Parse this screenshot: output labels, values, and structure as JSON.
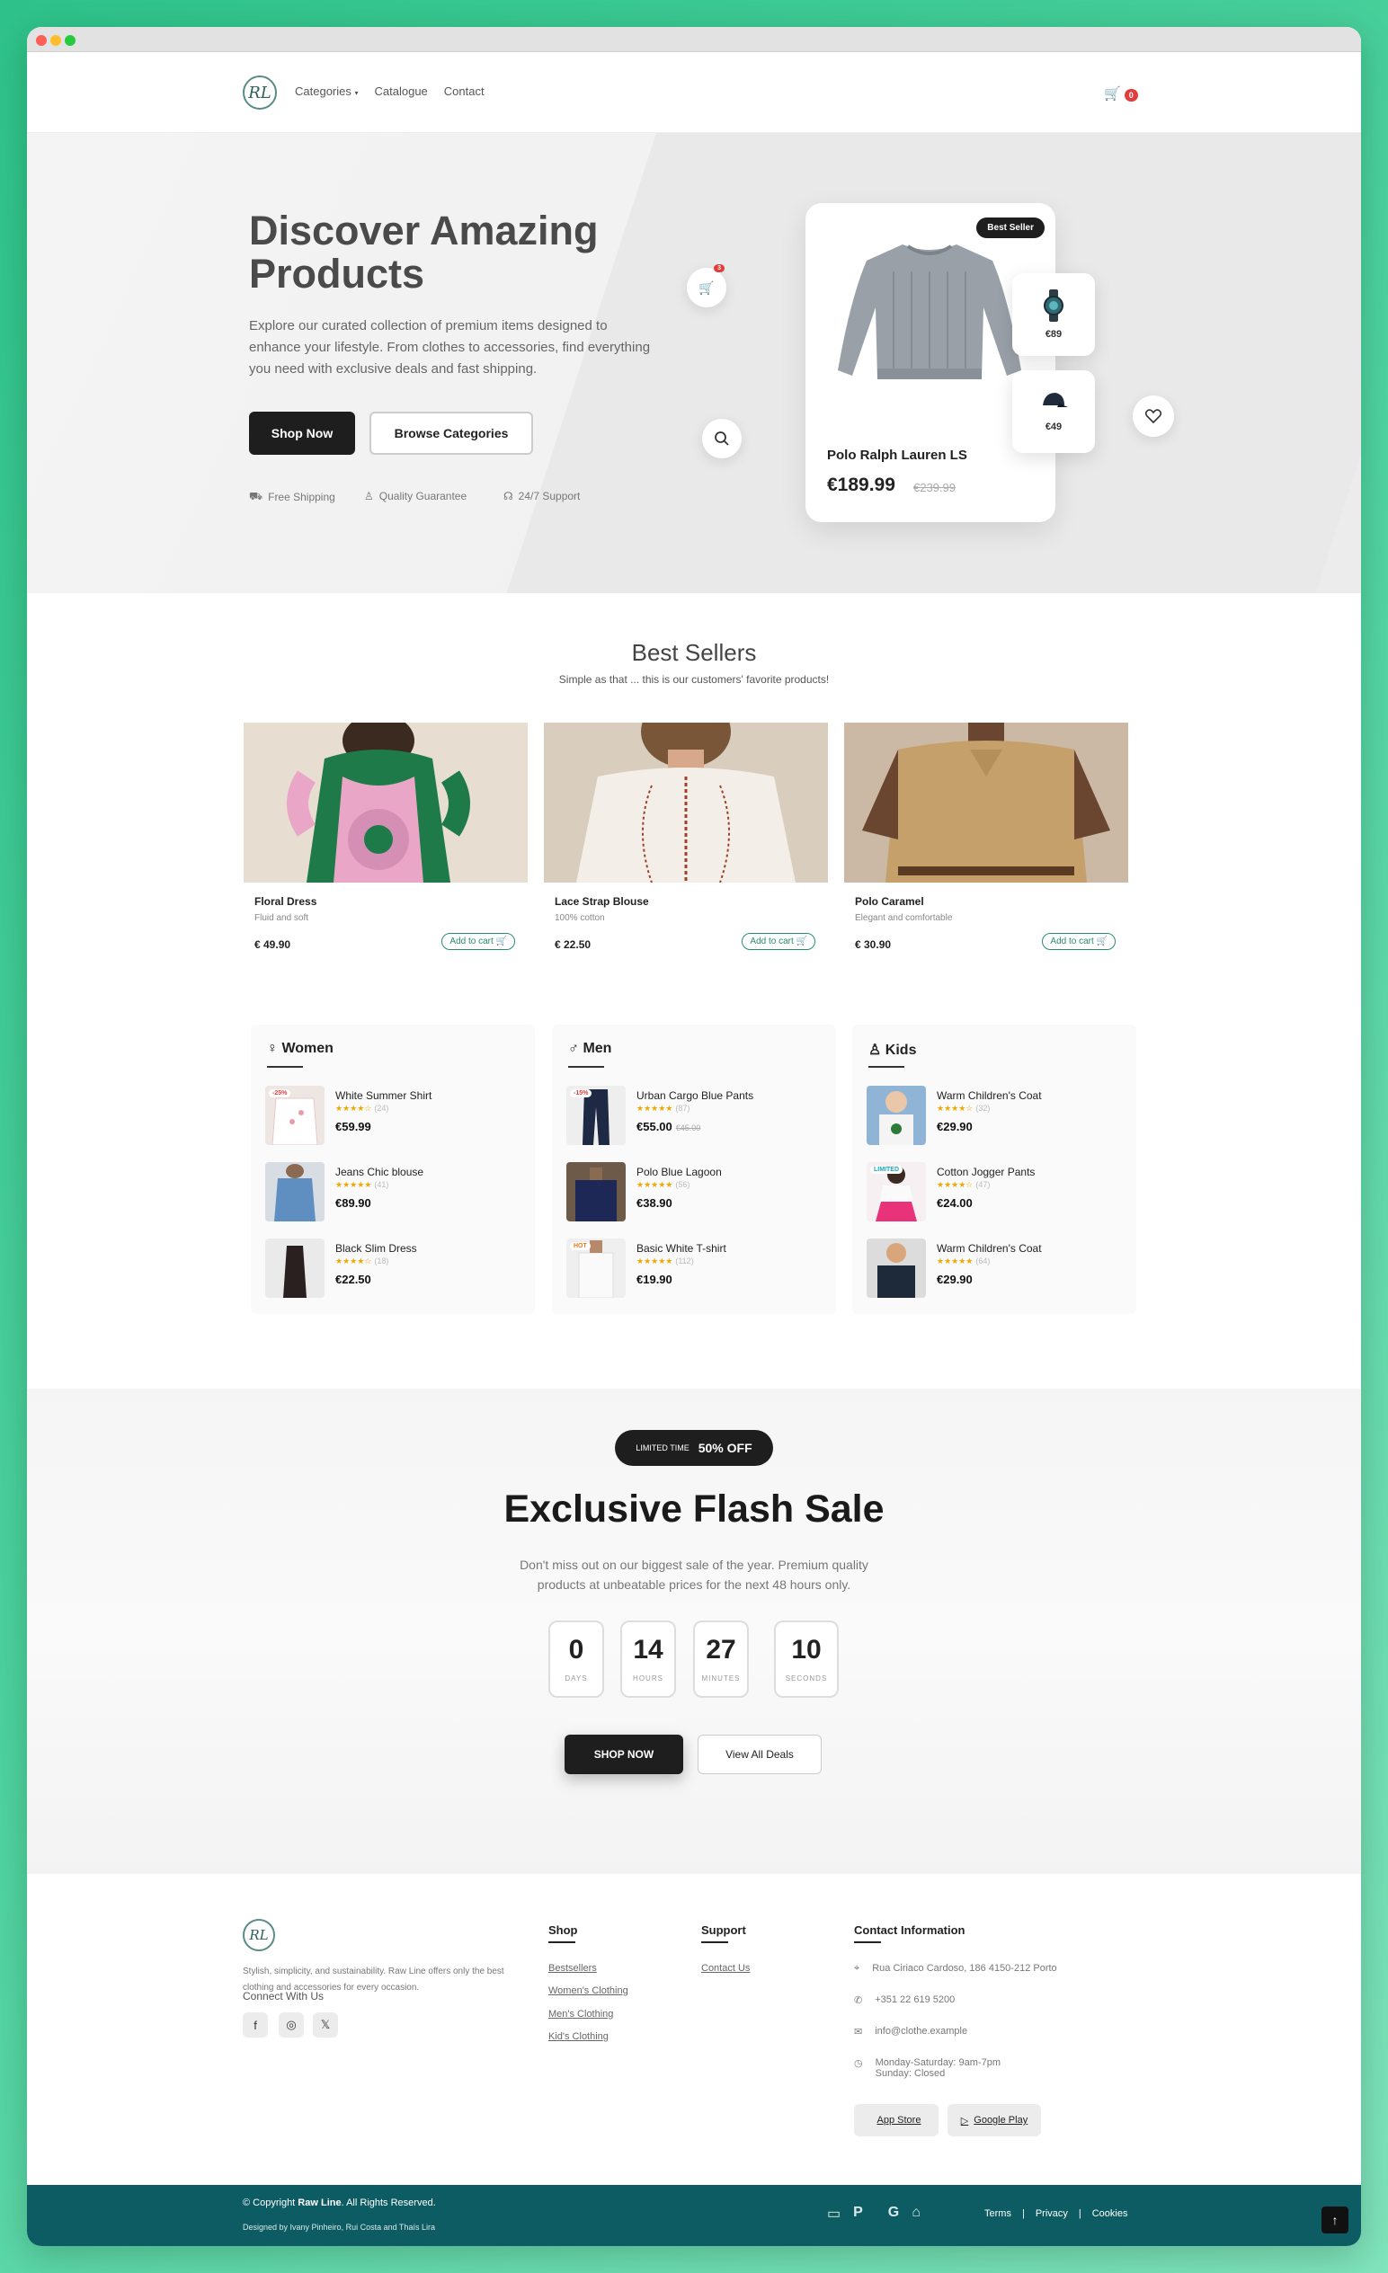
{
  "nav": {
    "categories": "Categories",
    "catalogue": "Catalogue",
    "contact": "Contact",
    "cart_count": "0",
    "logo_text": "RL"
  },
  "hero": {
    "title": "Discover Amazing Products",
    "description": "Explore our curated collection of premium items designed to enhance your lifestyle. From clothes to accessories, find everything you need with exclusive deals and fast shipping.",
    "shop_now": "Shop Now",
    "browse": "Browse Categories",
    "features": [
      "Free Shipping",
      "Quality Guarantee",
      "24/7 Support"
    ],
    "cart_bubble": "3",
    "product": {
      "badge": "Best Seller",
      "name": "Polo Ralph Lauren LS",
      "price": "€189.99",
      "old_price": "€239.99"
    },
    "mini_watch_price": "€89",
    "mini_cap_price": "€49"
  },
  "best_sellers": {
    "title": "Best Sellers",
    "subtitle": "Simple as that ... this is our customers' favorite products!",
    "items": [
      {
        "name": "Floral Dress",
        "desc": "Fluid and soft",
        "price": "€ 49.90",
        "cta": "Add to cart"
      },
      {
        "name": "Lace Strap Blouse",
        "desc": "100% cotton",
        "price": "€ 22.50",
        "cta": "Add to cart"
      },
      {
        "name": "Polo Caramel",
        "desc": "Elegant and comfortable",
        "price": "€ 30.90",
        "cta": "Add to cart"
      }
    ]
  },
  "categories": [
    {
      "title": "Women",
      "items": [
        {
          "name": "White Summer Shirt",
          "reviews": "(24)",
          "price": "€59.99",
          "old": "",
          "tag": "-25%",
          "rating": 4
        },
        {
          "name": "Jeans Chic blouse",
          "reviews": "(41)",
          "price": "€89.90",
          "old": "",
          "tag": "",
          "rating": 5
        },
        {
          "name": "Black Slim Dress",
          "reviews": "(18)",
          "price": "€22.50",
          "old": "",
          "tag": "",
          "rating": 4
        }
      ]
    },
    {
      "title": "Men",
      "items": [
        {
          "name": "Urban Cargo Blue Pants",
          "reviews": "(87)",
          "price": "€55.00",
          "old": "€45.00",
          "tag": "-15%",
          "rating": 5
        },
        {
          "name": "Polo Blue Lagoon",
          "reviews": "(56)",
          "price": "€38.90",
          "old": "",
          "tag": "",
          "rating": 5
        },
        {
          "name": "Basic White T-shirt",
          "reviews": "(112)",
          "price": "€19.90",
          "old": "",
          "tag": "HOT",
          "rating": 5
        }
      ]
    },
    {
      "title": "Kids",
      "items": [
        {
          "name": "Warm Children's Coat",
          "reviews": "(32)",
          "price": "€29.90",
          "old": "",
          "tag": "",
          "rating": 4
        },
        {
          "name": "Cotton Jogger Pants",
          "reviews": "(47)",
          "price": "€24.00",
          "old": "",
          "tag": "LIMITED",
          "rating": 4
        },
        {
          "name": "Warm Children's Coat",
          "reviews": "(64)",
          "price": "€29.90",
          "old": "",
          "tag": "",
          "rating": 5
        }
      ]
    }
  ],
  "flash": {
    "badge_small": "LIMITED TIME",
    "badge_big": "50% OFF",
    "title": "Exclusive Flash Sale",
    "text": "Don't miss out on our biggest sale of the year. Premium quality products at unbeatable prices for the next 48 hours only.",
    "countdown": [
      {
        "value": "0",
        "label": "DAYS"
      },
      {
        "value": "14",
        "label": "HOURS"
      },
      {
        "value": "27",
        "label": "MINUTES"
      },
      {
        "value": "10",
        "label": "SECONDS"
      }
    ],
    "shop_now": "SHOP NOW",
    "view_all": "View All Deals"
  },
  "footer": {
    "about": "Stylish, simplicity, and sustainability. Raw Line offers only the best clothing and accessories for every occasion.",
    "connect": "Connect With Us",
    "shop_title": "Shop",
    "shop_links": [
      "Bestsellers",
      "Women's Clothing",
      "Men's Clothing",
      "Kid's Clothing"
    ],
    "support_title": "Support",
    "support_links": [
      "Contact Us"
    ],
    "contact_title": "Contact Information",
    "address": "Rua Ciriaco Cardoso, 186 4150-212 Porto",
    "phone": "+351 22 619 5200",
    "email": "info@clothe.example",
    "hours1": "Monday-Saturday: 9am-7pm",
    "hours2": "Sunday: Closed",
    "app_store": "App Store",
    "google_play": "Google Play"
  },
  "bottom": {
    "copyright_pre": "© Copyright ",
    "brand": "Raw Line",
    "copyright_post": ". All Rights Reserved.",
    "designed": "Designed by Ivany Pinheiro, Rui Costa and Thaís Lira",
    "terms": "Terms",
    "privacy": "Privacy",
    "cookies": "Cookies"
  },
  "colors": {
    "accent": "#0d5c63",
    "dark": "#1e1e1e",
    "badge": "#e23d3d",
    "star": "#f0a800"
  }
}
